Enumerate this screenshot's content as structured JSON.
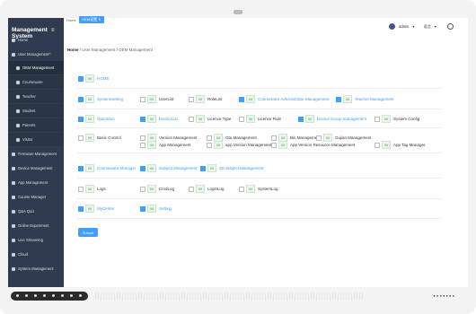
{
  "app": {
    "brand_line1": "Management",
    "brand_line2": "System"
  },
  "sidebar": {
    "items": [
      {
        "label": "Home"
      },
      {
        "label": "User Management"
      },
      {
        "label": "OEM Management"
      },
      {
        "label": "Courseware"
      },
      {
        "label": "Teacher"
      },
      {
        "label": "Student"
      },
      {
        "label": "Parents"
      },
      {
        "label": "Visitor"
      },
      {
        "label": "Firmware Management"
      },
      {
        "label": "Device Management"
      },
      {
        "label": "App Management"
      },
      {
        "label": "Course Manager"
      },
      {
        "label": "Q&A Quiz"
      },
      {
        "label": "Online Experiment"
      },
      {
        "label": "Live Streaming"
      },
      {
        "label": "Cloud"
      },
      {
        "label": "System Management"
      }
    ]
  },
  "tags": {
    "home": "Home",
    "oem": "OEM设置"
  },
  "header": {
    "user": "admin",
    "lang": "语言"
  },
  "breadcrumb": {
    "items": [
      "Home",
      "User Management",
      "OEM Management"
    ]
  },
  "permissions": {
    "rows": [
      [
        {
          "m": "M",
          "label": "HOME",
          "on": true
        }
      ],
      [
        {
          "m": "M",
          "label": "SystemSetting",
          "on": true
        },
        {
          "m": "M",
          "label": "UserList",
          "on": false
        },
        {
          "m": "M",
          "label": "RoleList",
          "on": false
        },
        {
          "m": "M",
          "label": "Courseware Administrator Management",
          "on": true
        },
        {
          "m": "M",
          "label": "Teacher Management",
          "on": true
        }
      ],
      [
        {
          "m": "M",
          "label": "Operation",
          "on": true
        },
        {
          "m": "M",
          "label": "DeviceList",
          "on": true
        },
        {
          "m": "M",
          "label": "Licence Type",
          "on": false
        },
        {
          "m": "M",
          "label": "Licence Rule",
          "on": false
        },
        {
          "m": "M",
          "label": "Device Group management",
          "on": true
        },
        {
          "m": "M",
          "label": "System Config",
          "on": false
        }
      ],
      [
        {
          "m": "M",
          "label": "Basic Control",
          "on": false
        },
        {
          "m": "M",
          "label": "Version Management",
          "on": false
        },
        {
          "m": "M",
          "label": "Ota Management",
          "on": false
        },
        {
          "m": "M",
          "label": "Bin Management",
          "on": false
        },
        {
          "m": "M",
          "label": "Gujian Management",
          "on": false
        },
        {
          "m": "M",
          "label": "App Management",
          "on": false
        },
        {
          "m": "M",
          "label": "app Version Management",
          "on": false
        },
        {
          "m": "M",
          "label": "App Version Resource Management",
          "on": false
        },
        {
          "m": "M",
          "label": "App Tag Manager",
          "on": false
        }
      ],
      [
        {
          "m": "M",
          "label": "Courseware Manager",
          "on": true
        },
        {
          "m": "M",
          "label": "Subject Management",
          "on": true
        },
        {
          "m": "M",
          "label": "3D Subject Management",
          "on": true
        }
      ],
      [
        {
          "m": "M",
          "label": "Logs",
          "on": false
        },
        {
          "m": "M",
          "label": "CmdLog",
          "on": false
        },
        {
          "m": "M",
          "label": "LoginLog",
          "on": false
        },
        {
          "m": "M",
          "label": "SystemLog",
          "on": false
        }
      ],
      [
        {
          "m": "M",
          "label": "MyCenter",
          "on": true
        },
        {
          "m": "M",
          "label": "Setting",
          "on": true
        }
      ]
    ],
    "submit": "Submit"
  }
}
